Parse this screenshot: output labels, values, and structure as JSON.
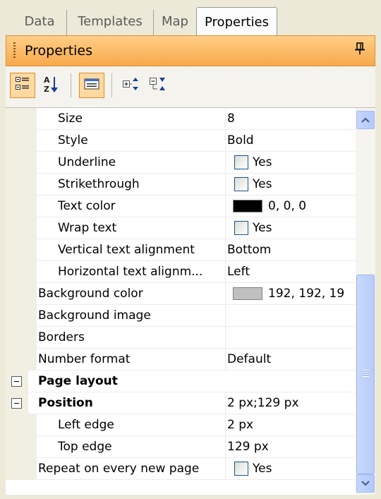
{
  "tabs": [
    {
      "label": "Data"
    },
    {
      "label": "Templates"
    },
    {
      "label": "Map"
    },
    {
      "label": "Properties"
    }
  ],
  "header": {
    "title": "Properties"
  },
  "toolbar": {
    "buttons": [
      {
        "name": "categorized-icon",
        "state": "active"
      },
      {
        "name": "alphabetical-sort-icon",
        "state": "normal"
      },
      {
        "name": "property-pages-icon",
        "state": "active"
      },
      {
        "name": "expand-all-icon",
        "state": "normal"
      },
      {
        "name": "collapse-all-icon",
        "state": "normal"
      }
    ]
  },
  "properties": [
    {
      "name": "Size",
      "value": "8"
    },
    {
      "name": "Style",
      "value": "Bold"
    },
    {
      "name": "Underline",
      "value": "Yes"
    },
    {
      "name": "Strikethrough",
      "value": "Yes"
    },
    {
      "name": "Text color",
      "value": "0, 0, 0"
    },
    {
      "name": "Wrap text",
      "value": "Yes"
    },
    {
      "name": "Vertical text alignment",
      "value": "Bottom"
    },
    {
      "name": "Horizontal text alignm...",
      "value": "Left"
    },
    {
      "name": "Background color",
      "value": "192, 192, 19"
    },
    {
      "name": "Background image",
      "value": ""
    },
    {
      "name": "Borders",
      "value": ""
    },
    {
      "name": "Number format",
      "value": "Default"
    },
    {
      "name": "Page layout",
      "value": ""
    },
    {
      "name": "Position",
      "value": "2 px;129 px"
    },
    {
      "name": "Left edge",
      "value": "2 px"
    },
    {
      "name": "Top edge",
      "value": "129 px"
    },
    {
      "name": "Repeat on every new page",
      "value": "Yes"
    }
  ],
  "colors": {
    "text_color_swatch": "#000000",
    "background_color_swatch": "#c0c0c0",
    "header_accent": "#f7a94a"
  }
}
